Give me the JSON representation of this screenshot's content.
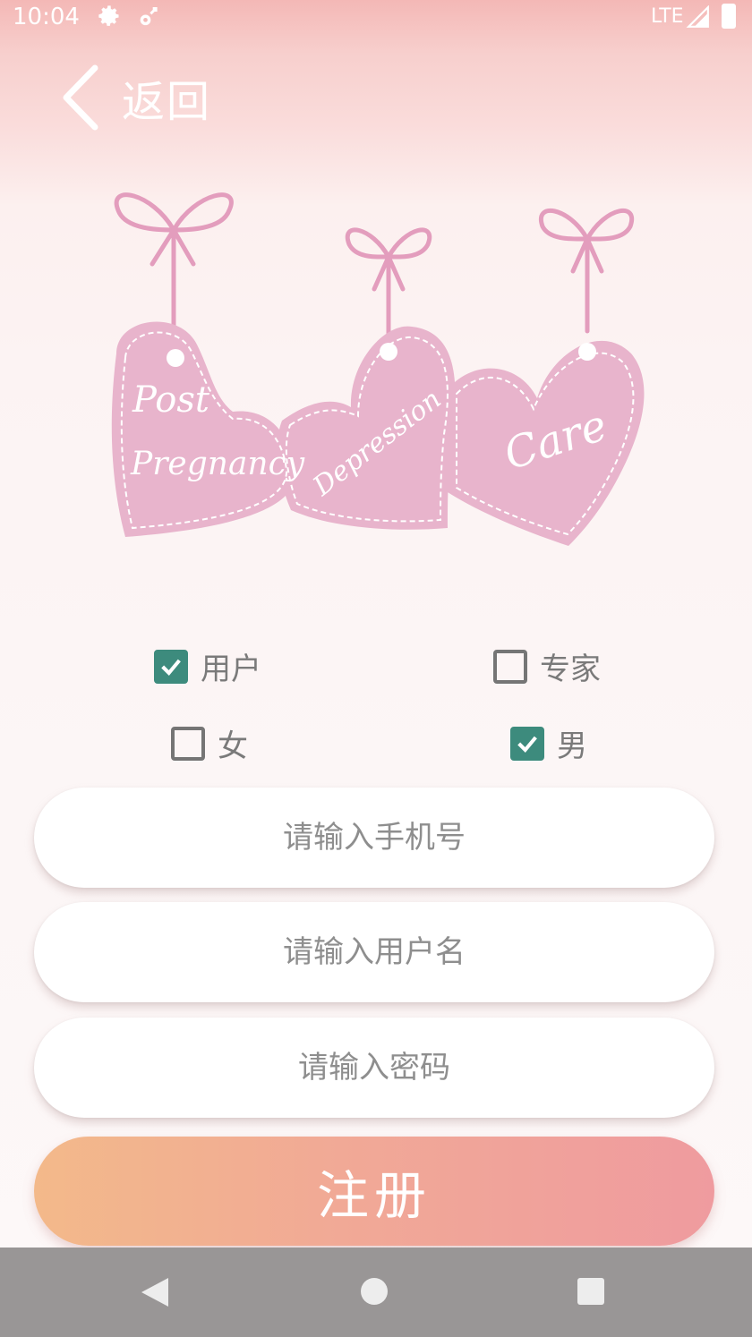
{
  "status_bar": {
    "time": "10:04",
    "network": "LTE",
    "icons": [
      "settings-gear-icon",
      "sync-gear-icon",
      "signal-icon",
      "battery-icon"
    ]
  },
  "header": {
    "back_label": "返回",
    "back_icon": "chevron-left-icon"
  },
  "logo": {
    "words": [
      "Post",
      "Pregnancy",
      "Depression",
      "Care"
    ],
    "color": "#e8b4cc"
  },
  "role_options": [
    {
      "label": "用户",
      "checked": true
    },
    {
      "label": "专家",
      "checked": false
    }
  ],
  "gender_options": [
    {
      "label": "女",
      "checked": false
    },
    {
      "label": "男",
      "checked": true
    }
  ],
  "form": {
    "phone_placeholder": "请输入手机号",
    "username_placeholder": "请输入用户名",
    "password_placeholder": "请输入密码",
    "register_label": "注册"
  },
  "colors": {
    "checkbox_checked": "#3d8b7d",
    "button_gradient_start": "#f3b98a",
    "button_gradient_end": "#ef9b9f",
    "nav_bar": "#999696"
  },
  "nav_bar": {
    "icons": [
      "back-triangle-icon",
      "home-circle-icon",
      "recents-square-icon"
    ]
  }
}
